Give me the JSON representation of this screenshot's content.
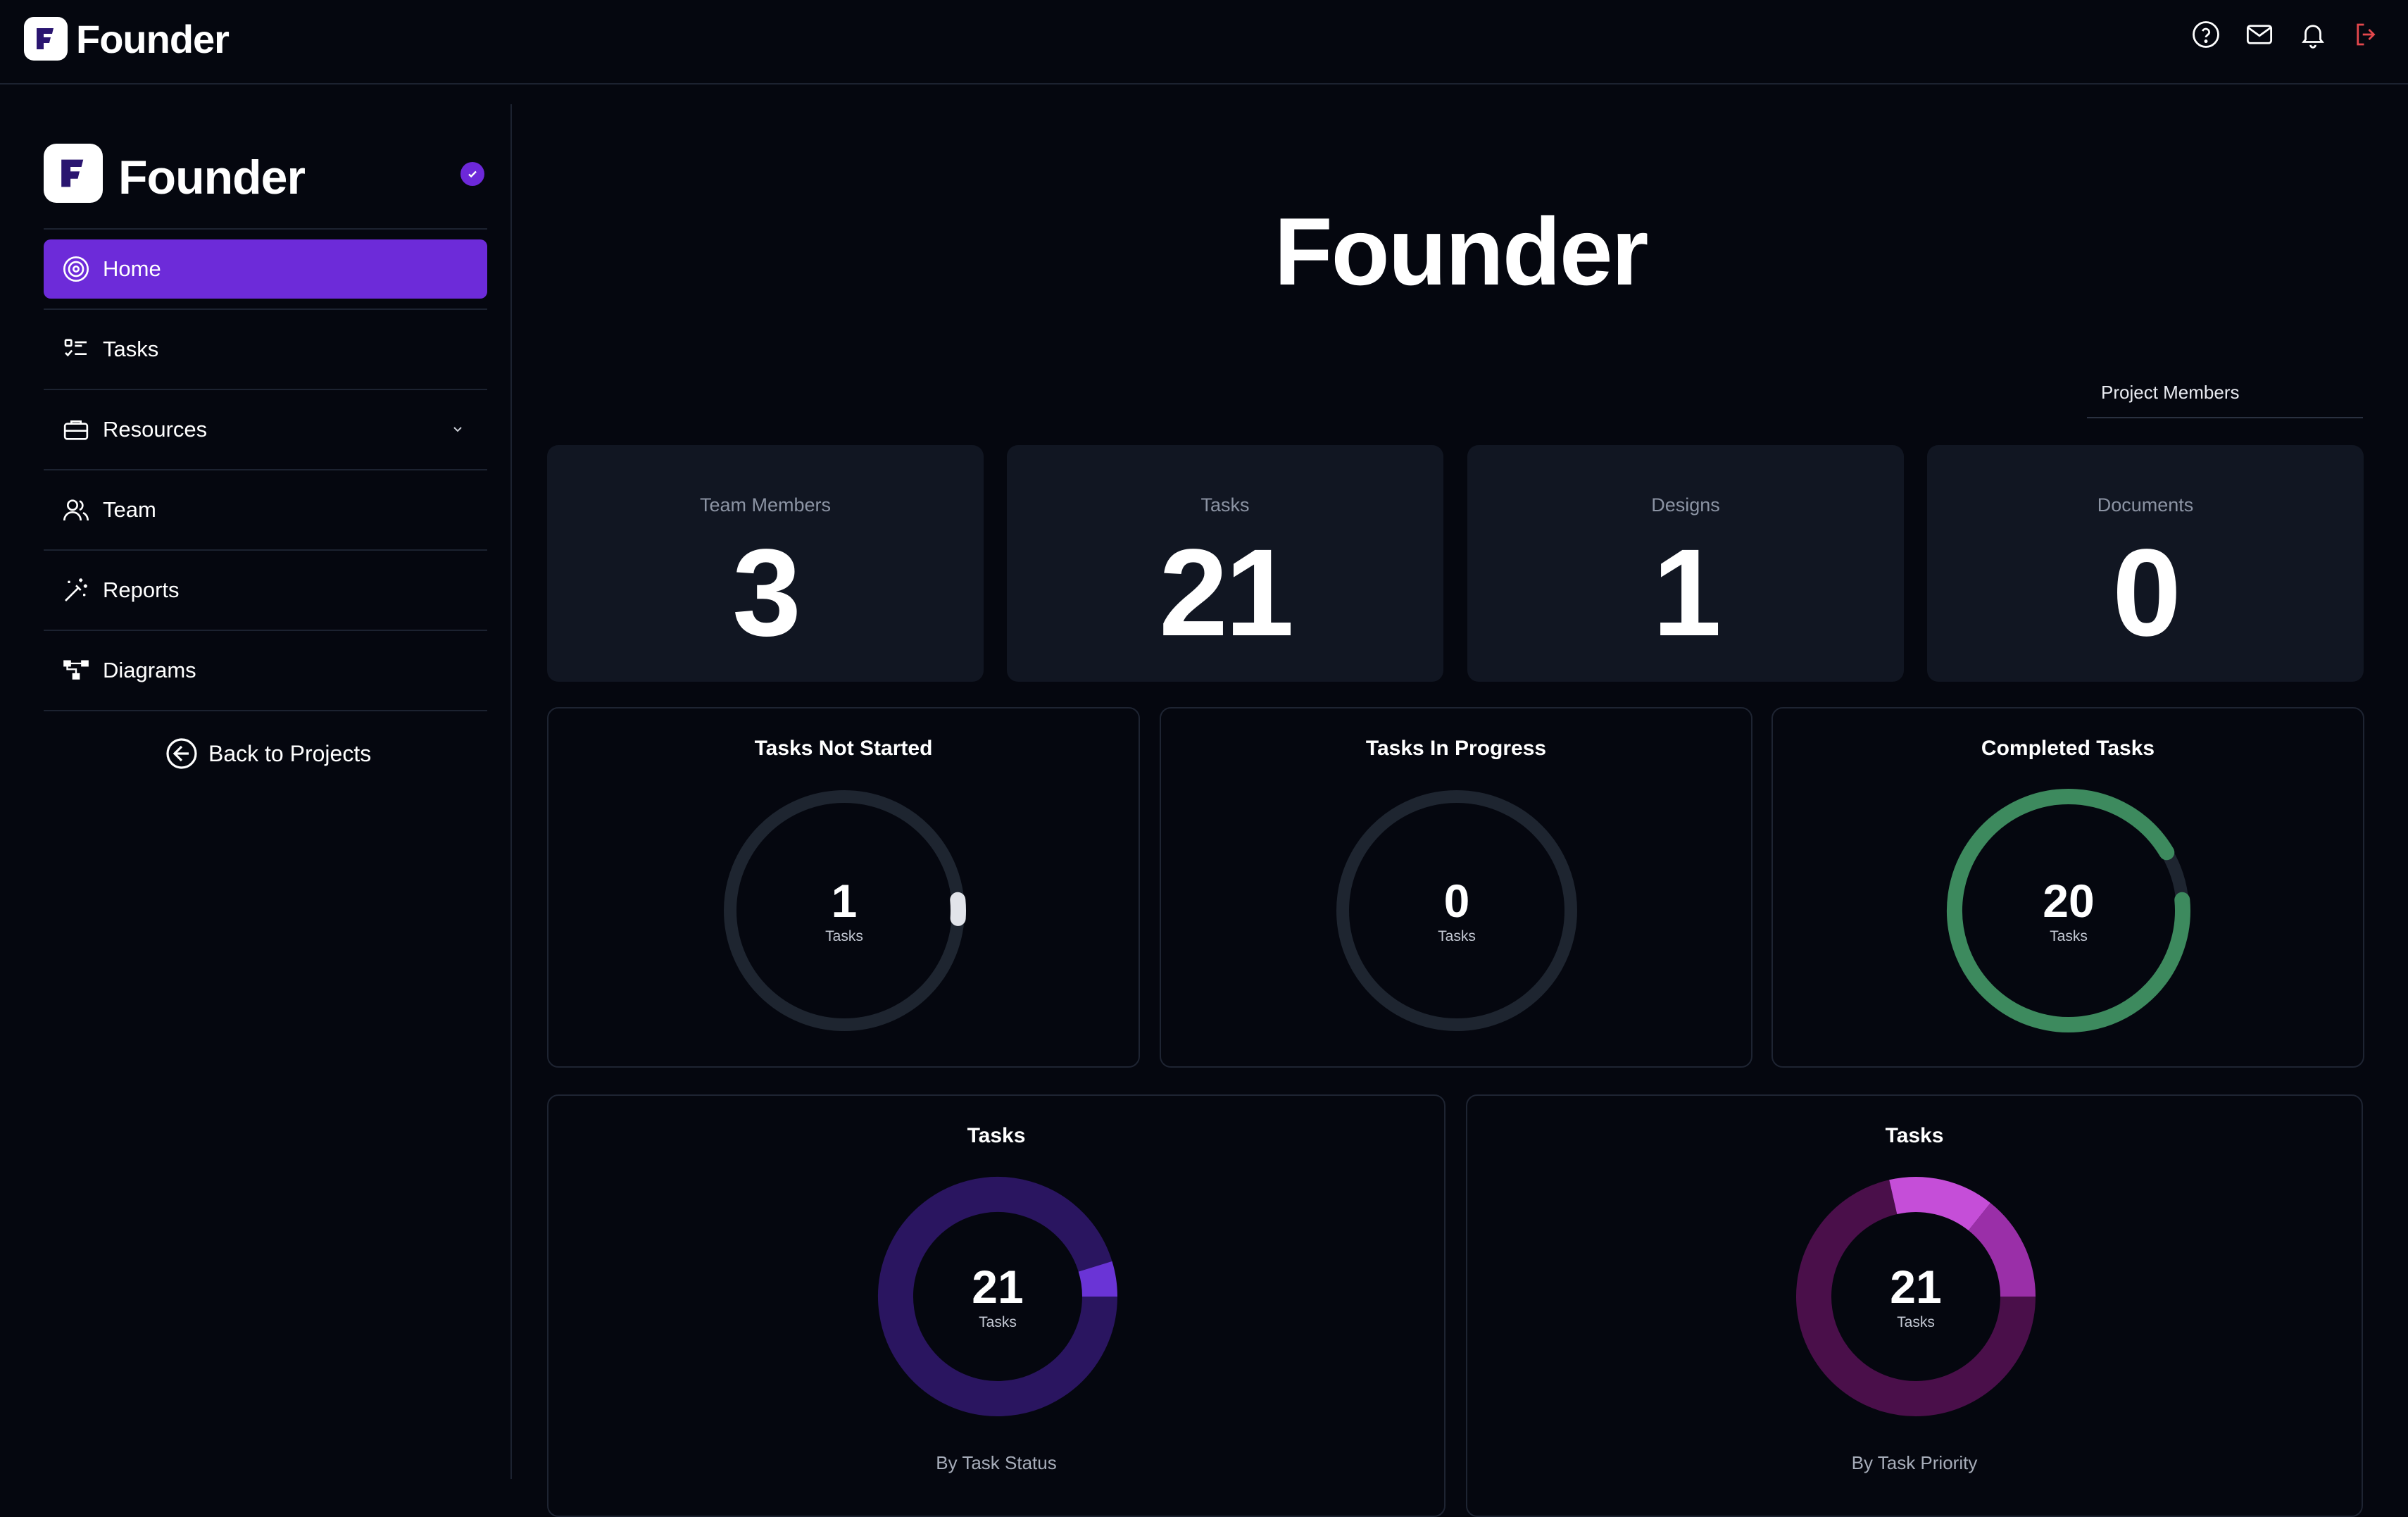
{
  "app": {
    "name": "Founder",
    "accent": "#6d2bd9",
    "background": "#05070f"
  },
  "topbar": {
    "icons": [
      "help-icon",
      "mail-icon",
      "bell-icon",
      "logout-icon"
    ]
  },
  "sidebar": {
    "project_name": "Founder",
    "verified_icon": "check-badge-icon",
    "items": [
      {
        "label": "Home",
        "icon": "target-icon",
        "active": true
      },
      {
        "label": "Tasks",
        "icon": "checklist-icon",
        "active": false
      },
      {
        "label": "Resources",
        "icon": "briefcase-icon",
        "active": false,
        "expandable": true
      },
      {
        "label": "Team",
        "icon": "people-icon",
        "active": false
      },
      {
        "label": "Reports",
        "icon": "magic-wand-icon",
        "active": false
      },
      {
        "label": "Diagrams",
        "icon": "diagram-icon",
        "active": false
      }
    ],
    "back_label": "Back to Projects"
  },
  "main": {
    "title": "Founder",
    "tab_label": "Project Members",
    "stats": [
      {
        "label": "Team Members",
        "value": "3"
      },
      {
        "label": "Tasks",
        "value": "21"
      },
      {
        "label": "Designs",
        "value": "1"
      },
      {
        "label": "Documents",
        "value": "0"
      }
    ],
    "progress_cards": [
      {
        "title": "Tasks Not Started",
        "value": "1",
        "unit": "Tasks",
        "fraction": 0.048,
        "color": "#e2e4ea",
        "track": "#1e2530"
      },
      {
        "title": "Tasks In Progress",
        "value": "0",
        "unit": "Tasks",
        "fraction": 0.0,
        "color": "#e2e4ea",
        "track": "#1e2530"
      },
      {
        "title": "Completed Tasks",
        "value": "20",
        "unit": "Tasks",
        "fraction": 0.952,
        "color": "#3d8a5e",
        "track": "#1e2530"
      }
    ],
    "distribution_cards": [
      {
        "title": "Tasks",
        "value": "21",
        "unit": "Tasks",
        "subtitle": "By Task Status",
        "segments": [
          {
            "value": 20,
            "color": "#2a1560"
          },
          {
            "value": 1,
            "color": "#6a34d6"
          }
        ]
      },
      {
        "title": "Tasks",
        "value": "21",
        "unit": "Tasks",
        "subtitle": "By Task Priority",
        "segments": [
          {
            "value": 15,
            "color": "#4a0f4a"
          },
          {
            "value": 3,
            "color": "#c54ed8"
          },
          {
            "value": 3,
            "color": "#9a2fa8"
          }
        ]
      }
    ]
  }
}
